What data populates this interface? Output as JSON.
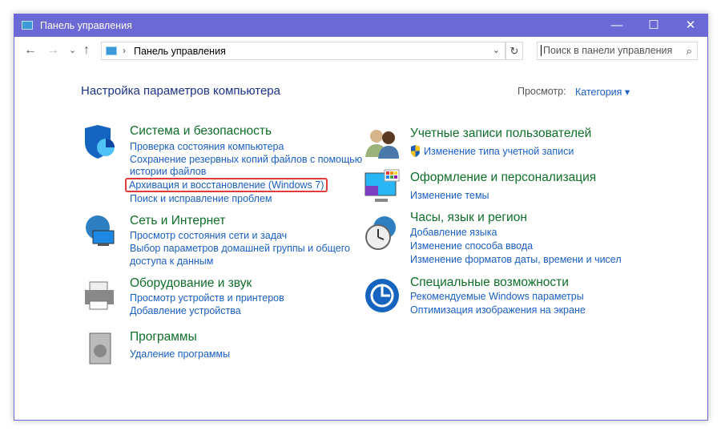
{
  "window": {
    "title": "Панель управления",
    "minimize": "—",
    "maximize": "☐",
    "close": "✕"
  },
  "nav": {
    "back": "←",
    "forward": "→",
    "recent": "⌄",
    "up": "↑",
    "breadcrumb": "Панель управления",
    "refresh": "↻",
    "search_placeholder": "Поиск в панели управления",
    "search_icon": "⌕"
  },
  "main": {
    "title": "Настройка параметров компьютера",
    "view_label": "Просмотр:",
    "view_value": "Категория ▾",
    "left": [
      {
        "heading": "Система и безопасность",
        "icon": "shield-icon",
        "links": [
          "Проверка состояния компьютера",
          "Сохранение резервных копий файлов с помощью",
          "истории файлов",
          "Архивация и восстановление (Windows 7)",
          "Поиск и исправление проблем"
        ]
      },
      {
        "heading": "Сеть и Интернет",
        "icon": "network-icon",
        "links": [
          "Просмотр состояния сети и задач",
          "Выбор параметров домашней группы и общего",
          "доступа к данным"
        ]
      },
      {
        "heading": "Оборудование и звук",
        "icon": "printer-icon",
        "links": [
          "Просмотр устройств и принтеров",
          "Добавление устройства"
        ]
      },
      {
        "heading": "Программы",
        "icon": "programs-icon",
        "links": [
          "Удаление программы"
        ]
      }
    ],
    "right": [
      {
        "heading": "Учетные записи пользователей",
        "icon": "users-icon",
        "links": [
          "Изменение типа учетной записи"
        ]
      },
      {
        "heading": "Оформление и персонализация",
        "icon": "display-icon",
        "links": [
          "Изменение темы"
        ]
      },
      {
        "heading": "Часы, язык и регион",
        "icon": "clock-icon",
        "links": [
          "Добавление языка",
          "Изменение способа ввода",
          "Изменение форматов даты, времени и чисел"
        ]
      },
      {
        "heading": "Специальные возможности",
        "icon": "accessibility-icon",
        "links": [
          "Рекомендуемые Windows параметры",
          "Оптимизация изображения на экране"
        ]
      }
    ]
  },
  "colors": {
    "titlebar": "#6b69d6",
    "heading": "#0f6e2a",
    "link": "#1a5fc4",
    "highlight": "#e03c3c"
  }
}
